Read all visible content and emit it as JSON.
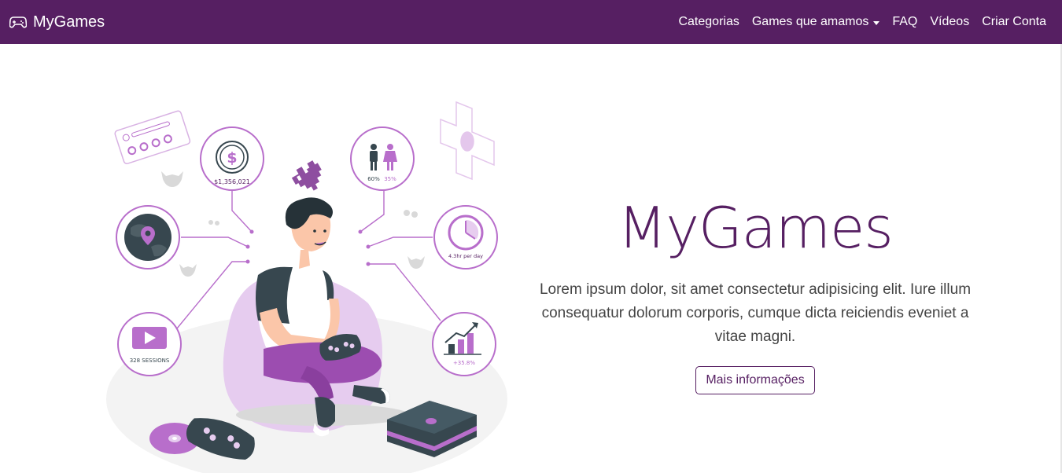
{
  "navbar": {
    "brand": "MyGames",
    "brand_icon": "gamepad-icon",
    "links": [
      {
        "label": "Categorias"
      },
      {
        "label": "Games que amamos",
        "dropdown": true
      },
      {
        "label": "FAQ"
      },
      {
        "label": "Vídeos"
      },
      {
        "label": "Criar Conta"
      }
    ]
  },
  "hero": {
    "title": "MyGames",
    "description": "Lorem ipsum dolor, sit amet consectetur adipisicing elit. Iure illum consequatur dolorum corporis, cumque dicta reiciendis eveniet a vitae magni.",
    "button_label": "Mais informações"
  },
  "illustration": {
    "money": "$1,356,021",
    "gender_male": "60%",
    "gender_female": "35%",
    "time": "4.3hr per day",
    "sessions": "328 SESSIONS",
    "growth": "+35.8%"
  },
  "colors": {
    "navbar_bg": "#561f62",
    "accent": "#561f62",
    "illustration_purple": "#b86ecb",
    "illustration_dark": "#37474f"
  }
}
